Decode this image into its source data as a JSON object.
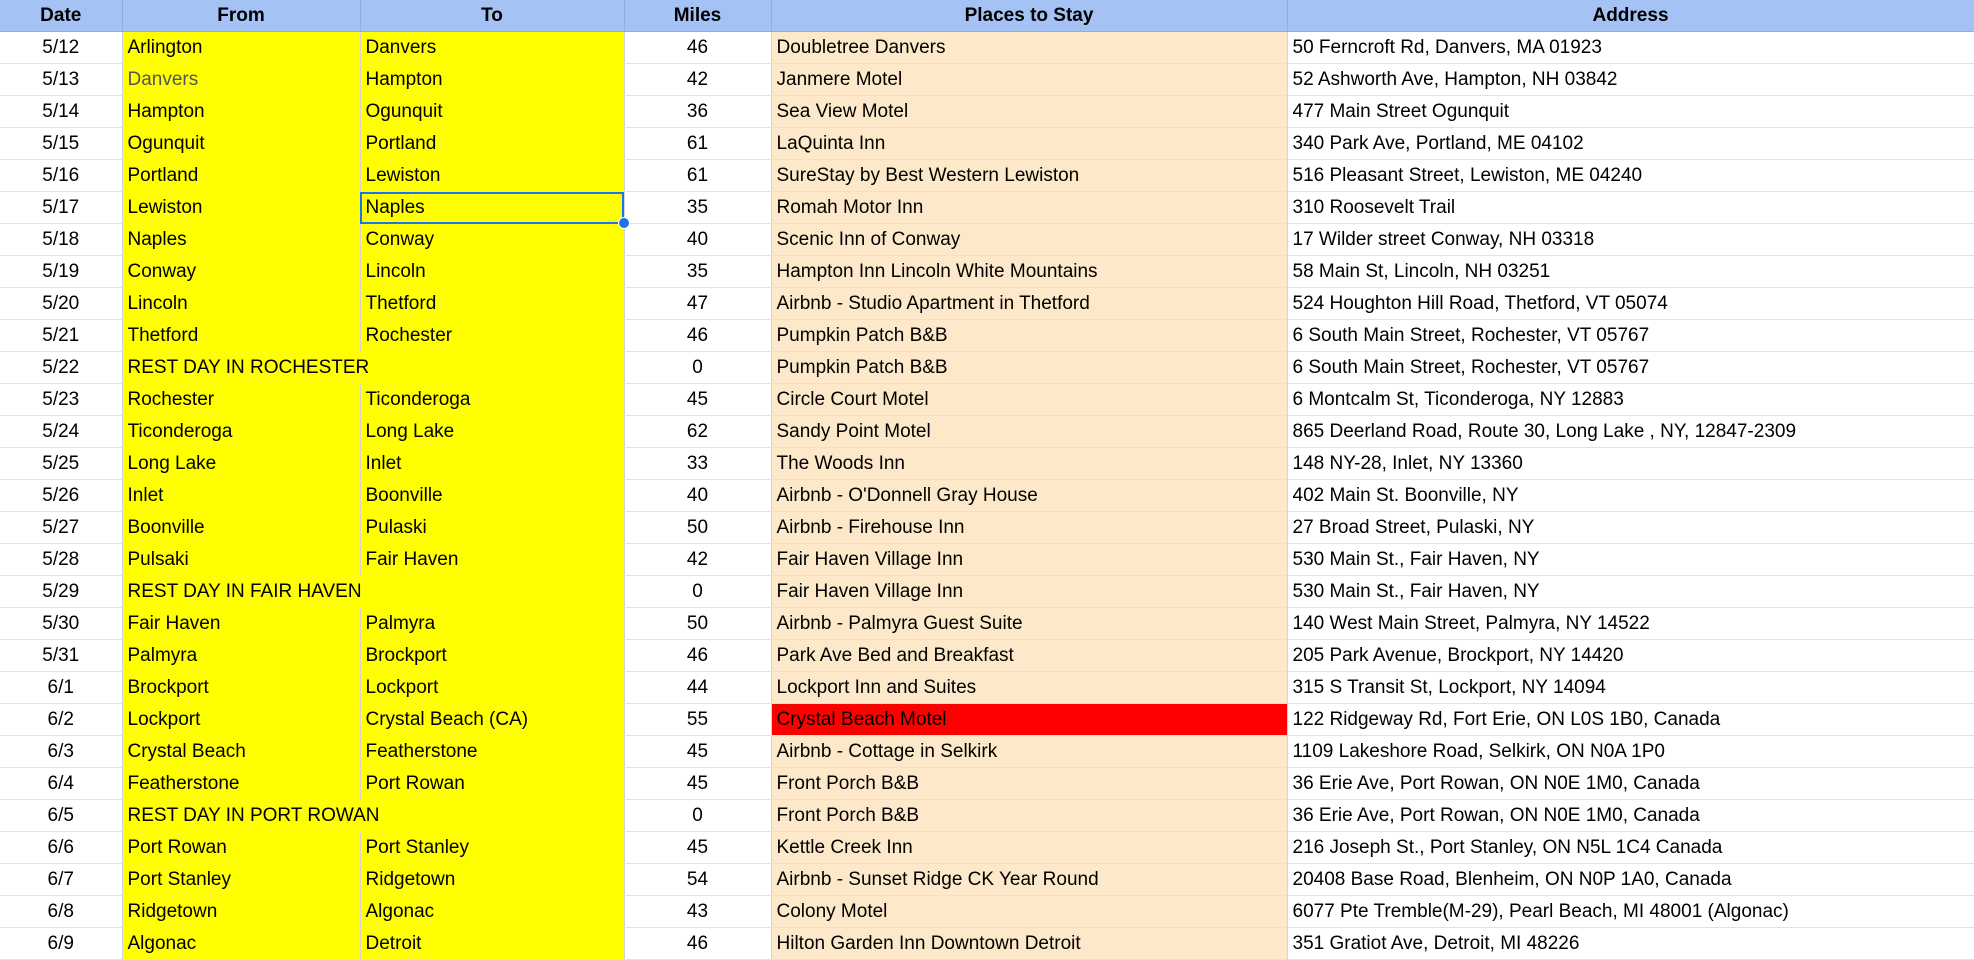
{
  "colors": {
    "header_bg": "#a4c2f4",
    "route_bg": "#ffff00",
    "place_bg": "#fde9c9",
    "alert_bg": "#ff0000",
    "selection": "#1a73e8"
  },
  "headers": {
    "date": "Date",
    "from": "From",
    "to": "To",
    "miles": "Miles",
    "place": "Places to Stay",
    "address": "Address"
  },
  "selected": {
    "row": 5,
    "column": "to"
  },
  "rows": [
    {
      "date": "5/12",
      "from": "Arlington",
      "to": "Danvers",
      "miles": "46",
      "place": "Doubletree Danvers",
      "address": "50 Ferncroft Rd, Danvers, MA 01923"
    },
    {
      "date": "5/13",
      "from": "Danvers",
      "to": "Hampton",
      "miles": "42",
      "place": "Janmere Motel",
      "address": "52 Ashworth Ave, Hampton, NH 03842",
      "dim_from": true
    },
    {
      "date": "5/14",
      "from": "Hampton",
      "to": "Ogunquit",
      "miles": "36",
      "place": "Sea View Motel",
      "address": "477 Main Street Ogunquit"
    },
    {
      "date": "5/15",
      "from": "Ogunquit",
      "to": "Portland",
      "miles": "61",
      "place": "LaQuinta Inn",
      "address": "340 Park Ave, Portland, ME 04102"
    },
    {
      "date": "5/16",
      "from": "Portland",
      "to": "Lewiston",
      "miles": "61",
      "place": "SureStay by Best Western Lewiston",
      "address": "516 Pleasant Street, Lewiston, ME 04240"
    },
    {
      "date": "5/17",
      "from": "Lewiston",
      "to": "Naples",
      "miles": "35",
      "place": "Romah Motor Inn",
      "address": "310 Roosevelt Trail"
    },
    {
      "date": "5/18",
      "from": "Naples",
      "to": "Conway",
      "miles": "40",
      "place": "Scenic Inn of Conway",
      "address": "17 Wilder street Conway, NH 03318"
    },
    {
      "date": "5/19",
      "from": "Conway",
      "to": "Lincoln",
      "miles": "35",
      "place": "Hampton Inn Lincoln White Mountains",
      "address": "58 Main St, Lincoln, NH 03251"
    },
    {
      "date": "5/20",
      "from": "Lincoln",
      "to": "Thetford",
      "miles": "47",
      "place": "Airbnb - Studio Apartment in Thetford",
      "address": "524 Houghton Hill Road, Thetford, VT 05074"
    },
    {
      "date": "5/21",
      "from": "Thetford",
      "to": "Rochester",
      "miles": "46",
      "place": "Pumpkin Patch B&B",
      "address": "6 South Main Street, Rochester, VT 05767"
    },
    {
      "date": "5/22",
      "from": "REST DAY IN ROCHESTER",
      "to": "",
      "span": true,
      "miles": "0",
      "place": "Pumpkin Patch B&B",
      "address": "6 South Main Street, Rochester, VT 05767"
    },
    {
      "date": "5/23",
      "from": "Rochester",
      "to": "Ticonderoga",
      "miles": "45",
      "place": "Circle Court Motel",
      "address": "6 Montcalm St, Ticonderoga, NY 12883"
    },
    {
      "date": "5/24",
      "from": "Ticonderoga",
      "to": "Long Lake",
      "miles": "62",
      "place": "Sandy Point Motel",
      "address": "865 Deerland Road, Route 30, Long Lake , NY, 12847-2309"
    },
    {
      "date": "5/25",
      "from": "Long Lake",
      "to": "Inlet",
      "miles": "33",
      "place": "The Woods Inn",
      "address": "148 NY-28, Inlet, NY 13360"
    },
    {
      "date": "5/26",
      "from": "Inlet",
      "to": "Boonville",
      "miles": "40",
      "place": "Airbnb - O'Donnell Gray House",
      "address": "402 Main St. Boonville, NY"
    },
    {
      "date": "5/27",
      "from": "Boonville",
      "to": "Pulaski",
      "miles": "50",
      "place": "Airbnb - Firehouse Inn",
      "address": "27 Broad Street, Pulaski, NY"
    },
    {
      "date": "5/28",
      "from": "Pulsaki",
      "to": "Fair Haven",
      "miles": "42",
      "place": "Fair Haven Village Inn",
      "address": "530 Main St., Fair Haven, NY"
    },
    {
      "date": "5/29",
      "from": "REST DAY IN FAIR HAVEN",
      "to": "",
      "span": true,
      "miles": "0",
      "place": "Fair Haven Village Inn",
      "address": "530 Main St., Fair Haven, NY"
    },
    {
      "date": "5/30",
      "from": "Fair Haven",
      "to": "Palmyra",
      "miles": "50",
      "place": "Airbnb - Palmyra Guest Suite",
      "address": "140 West Main Street, Palmyra, NY 14522"
    },
    {
      "date": "5/31",
      "from": "Palmyra",
      "to": "Brockport",
      "miles": "46",
      "place": "Park Ave Bed and Breakfast",
      "address": "205 Park Avenue, Brockport, NY 14420"
    },
    {
      "date": "6/1",
      "from": "Brockport",
      "to": "Lockport",
      "miles": "44",
      "place": "Lockport Inn and Suites",
      "address": "315 S Transit St, Lockport, NY 14094"
    },
    {
      "date": "6/2",
      "from": "Lockport",
      "to": "Crystal Beach (CA)",
      "miles": "55",
      "place": "Crystal Beach Motel",
      "address": "122 Ridgeway Rd, Fort Erie, ON L0S 1B0, Canada",
      "alert": true
    },
    {
      "date": "6/3",
      "from": "Crystal Beach",
      "to": "Featherstone",
      "miles": "45",
      "place": "Airbnb - Cottage in Selkirk",
      "address": "1109 Lakeshore Road, Selkirk, ON N0A 1P0"
    },
    {
      "date": "6/4",
      "from": "Featherstone",
      "to": "Port Rowan",
      "miles": "45",
      "place": "Front Porch B&B",
      "address": "36 Erie Ave, Port Rowan, ON N0E 1M0, Canada"
    },
    {
      "date": "6/5",
      "from": "REST DAY IN PORT ROWAN",
      "to": "",
      "span": true,
      "miles": "0",
      "place": "Front Porch B&B",
      "address": "36 Erie Ave, Port Rowan, ON N0E 1M0, Canada"
    },
    {
      "date": "6/6",
      "from": "Port Rowan",
      "to": "Port Stanley",
      "miles": "45",
      "place": "Kettle Creek Inn",
      "address": "216 Joseph St., Port Stanley, ON N5L 1C4 Canada"
    },
    {
      "date": "6/7",
      "from": "Port Stanley",
      "to": "Ridgetown",
      "miles": "54",
      "place": "Airbnb - Sunset Ridge CK Year Round",
      "address": "20408 Base Road, Blenheim, ON N0P 1A0, Canada"
    },
    {
      "date": "6/8",
      "from": "Ridgetown",
      "to": "Algonac",
      "miles": "43",
      "place": "Colony Motel",
      "address": "6077 Pte Tremble(M-29), Pearl Beach, MI 48001 (Algonac)"
    },
    {
      "date": "6/9",
      "from": "Algonac",
      "to": "Detroit",
      "miles": "46",
      "place": "Hilton Garden Inn Downtown Detroit",
      "address": "351 Gratiot Ave, Detroit, MI 48226"
    }
  ]
}
